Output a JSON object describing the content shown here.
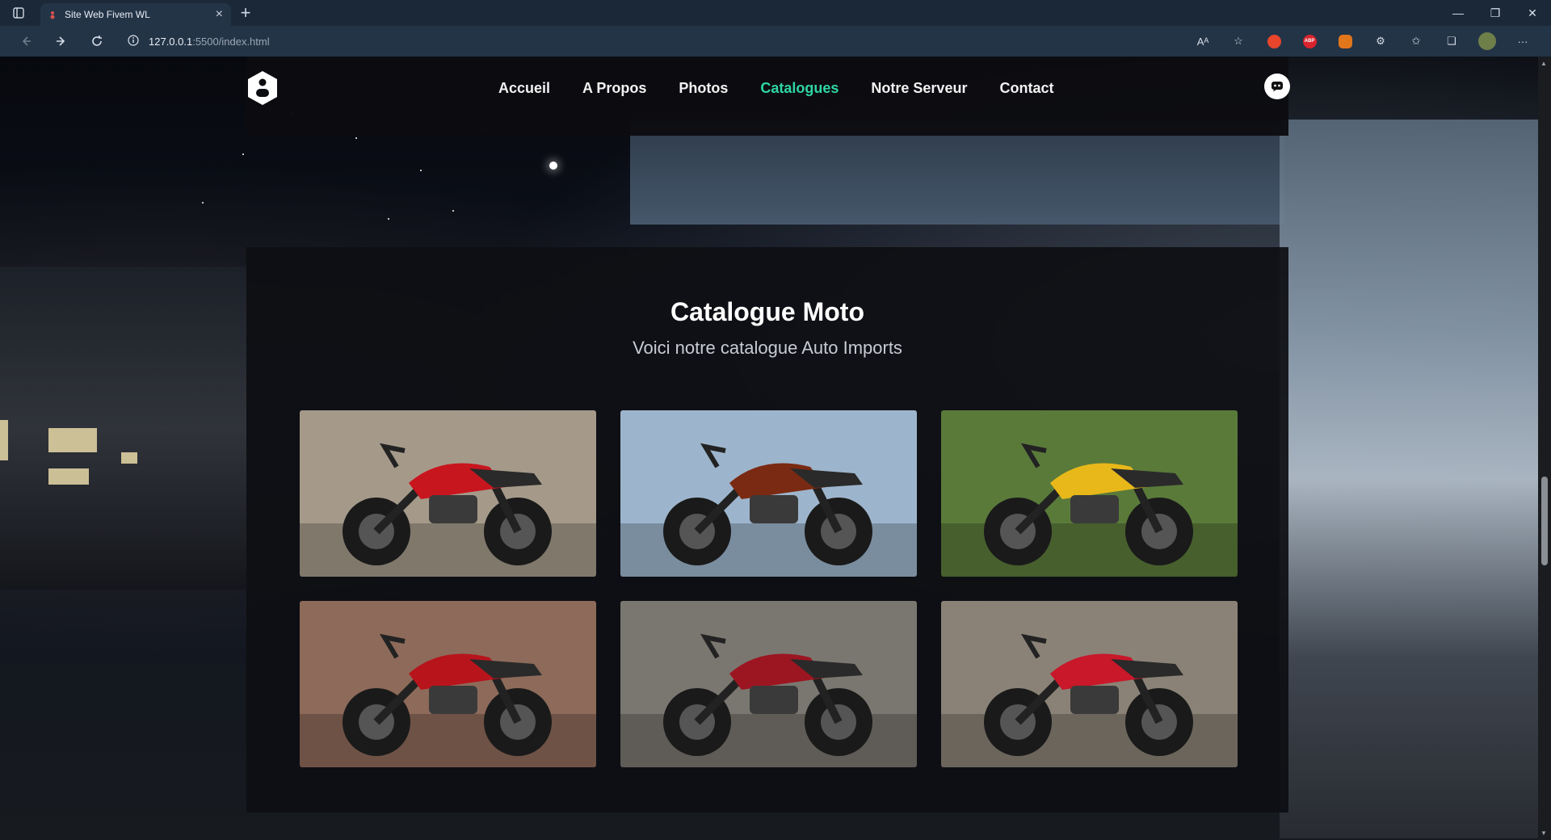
{
  "browser": {
    "tab_title": "Site Web Fivem WL",
    "url_host": "127.0.0.1",
    "url_path": ":5500/index.html",
    "extensions": [
      "read-aloud-icon",
      "favorite-star-icon",
      "honey-extension-icon",
      "adblock-plus-icon",
      "metamask-icon",
      "extensions-puzzle-icon",
      "favorites-icon",
      "collections-icon",
      "profile-avatar-icon",
      "more-menu-icon"
    ],
    "abp_label": "ABP"
  },
  "nav": {
    "links": [
      "Accueil",
      "A Propos",
      "Photos",
      "Catalogues",
      "Notre Serveur",
      "Contact"
    ],
    "active": "Catalogues"
  },
  "catalogue": {
    "title": "Catalogue Moto",
    "subtitle": "Voici notre catalogue Auto Imports",
    "items": [
      {
        "name": "moto-1",
        "body": "#c8161f",
        "bg": "#a59a8a"
      },
      {
        "name": "moto-2",
        "body": "#7a2a12",
        "bg": "#9db5cc"
      },
      {
        "name": "moto-3",
        "body": "#e8b81a",
        "bg": "#5a7a3a"
      },
      {
        "name": "moto-4",
        "body": "#b8141c",
        "bg": "#8d6a5a"
      },
      {
        "name": "moto-5",
        "body": "#9c1622",
        "bg": "#7a7770"
      },
      {
        "name": "moto-6",
        "body": "#c8182a",
        "bg": "#8a8276"
      }
    ]
  },
  "colors": {
    "accent": "#2fd6a3",
    "nav_bg": "#0c0d11",
    "section_bg": "#0e0f13"
  }
}
